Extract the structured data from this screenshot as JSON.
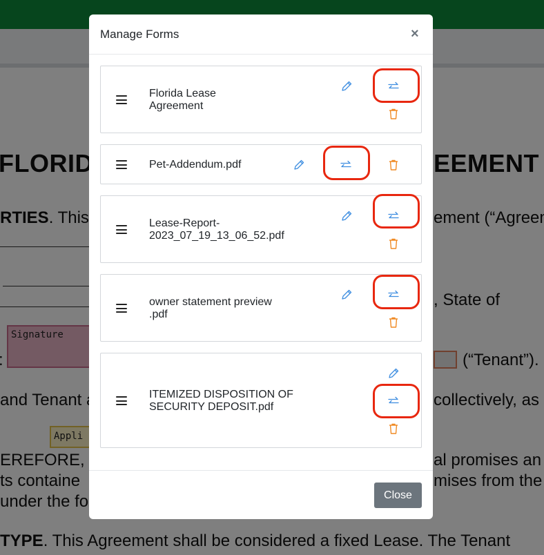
{
  "modal": {
    "title": "Manage Forms",
    "close_x": "×",
    "close_button": "Close"
  },
  "forms": [
    {
      "name": "Florida Lease\nAgreement"
    },
    {
      "name": "Pet-Addendum.pdf"
    },
    {
      "name": "Lease-Report-\n2023_07_19_13_06_52.pdf"
    },
    {
      "name": "owner statement preview\n.pdf"
    },
    {
      "name": "ITEMIZED DISPOSITION OF\nSECURITY DEPOSIT.pdf"
    }
  ],
  "background": {
    "title_left": "FLORID",
    "title_right": "EEMENT",
    "parties_bold": "RTIES",
    "parties_rest": ". This",
    "agreement": "ement (“Agreeme",
    "state_of": ", State of",
    "tenant_label": ":",
    "tenant_text": "(“Tenant”).",
    "and_tenant": "and Tenant a",
    "collectively": "collectively, as",
    "signature": "Signature",
    "appli": "Appli",
    "whereas": "EREFORE,",
    "promises": "al promises an",
    "contained": "ts containe",
    "promises_from": "mises from the",
    "under": "under the fol",
    "type_bold": "TYPE",
    "type_rest": ". This Agreement shall be considered a fixed Lease. The Tenant"
  },
  "colors": {
    "edit": "#3d8de0",
    "swap": "#3d8de0",
    "delete": "#f08a24",
    "highlight": "#e8270f",
    "topbar": "#0d8a3a"
  }
}
